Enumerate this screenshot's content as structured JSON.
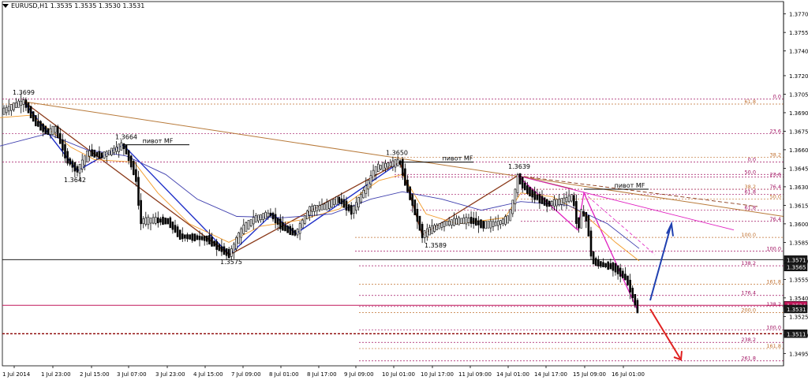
{
  "header": {
    "symbol_timeframe": "EURUSD,H1",
    "ohlc": "1.3535 1.3535 1.3530 1.3531"
  },
  "chart_data": {
    "type": "candlestick",
    "symbol": "EURUSD",
    "timeframe": "H1",
    "ylim": [
      1.3485,
      1.378
    ],
    "y_ticks": [
      "1.3770",
      "1.3755",
      "1.3740",
      "1.3720",
      "1.3705",
      "1.3690",
      "1.3675",
      "1.3660",
      "1.3645",
      "1.3630",
      "1.3615",
      "1.3600",
      "1.3585",
      "1.3570",
      "1.3555",
      "1.3540",
      "1.3525",
      "1.3510",
      "1.3495"
    ],
    "x_ticks": [
      "1 Jul 2014",
      "1 Jul 23:00",
      "2 Jul 15:00",
      "3 Jul 07:00",
      "3 Jul 23:00",
      "4 Jul 15:00",
      "7 Jul 09:00",
      "8 Jul 01:00",
      "8 Jul 17:00",
      "9 Jul 09:00",
      "10 Jul 01:00",
      "10 Jul 17:00",
      "11 Jul 09:00",
      "14 Jul 01:00",
      "14 Jul 17:00",
      "15 Jul 09:00",
      "16 Jul 01:00"
    ],
    "price_tags": [
      {
        "label": "1.3571",
        "value": 1.3571,
        "color": "#ffffff"
      },
      {
        "label": "1.3565",
        "value": 1.3565,
        "color": "#ffffff"
      },
      {
        "label": "1.3534",
        "value": 1.3534,
        "color": "#c2185b"
      },
      {
        "label": "1.3531",
        "value": 1.3531,
        "color": "#ffffff"
      },
      {
        "label": "1.3511",
        "value": 1.3511,
        "color": "#ffffff"
      }
    ],
    "swing_points": [
      {
        "label": "1.3699",
        "value": 1.3699
      },
      {
        "label": "1.3664",
        "value": 1.3664
      },
      {
        "label": "1.3642",
        "value": 1.3642
      },
      {
        "label": "1.3575",
        "value": 1.3575
      },
      {
        "label": "1.3650",
        "value": 1.365
      },
      {
        "label": "1.3589",
        "value": 1.3589
      },
      {
        "label": "1.3639",
        "value": 1.3639
      }
    ],
    "annotations": [
      {
        "text": "пивот MF",
        "value": 1.3664
      },
      {
        "text": "пивот MF",
        "value": 1.365
      },
      {
        "text": "пивот MF",
        "value": 1.3628
      }
    ],
    "fib_levels": [
      {
        "label": "0.0",
        "value": 1.3701
      },
      {
        "label": "61.8",
        "value": 1.3697
      },
      {
        "label": "23.6",
        "value": 1.3673
      },
      {
        "label": "0.0",
        "value": 1.365
      },
      {
        "label": "38.2",
        "value": 1.3654
      },
      {
        "label": "50.0",
        "value": 1.364
      },
      {
        "label": "23.6",
        "value": 1.3638
      },
      {
        "label": "38.2",
        "value": 1.3628
      },
      {
        "label": "76.4",
        "value": 1.3628
      },
      {
        "label": "61.8",
        "value": 1.3624
      },
      {
        "label": "50.0",
        "value": 1.362
      },
      {
        "label": "61.8",
        "value": 1.3611
      },
      {
        "label": "76.4",
        "value": 1.3602
      },
      {
        "label": "100.0",
        "value": 1.3589
      },
      {
        "label": "100.0",
        "value": 1.3578
      },
      {
        "label": "138.2",
        "value": 1.3566
      },
      {
        "label": "161.8",
        "value": 1.3551
      },
      {
        "label": "176.4",
        "value": 1.3542
      },
      {
        "label": "138.2",
        "value": 1.3533
      },
      {
        "label": "200.0",
        "value": 1.3528
      },
      {
        "label": "100.0",
        "value": 1.3514
      },
      {
        "label": "238.2",
        "value": 1.3504
      },
      {
        "label": "161.8",
        "value": 1.3499
      },
      {
        "label": "261.8",
        "value": 1.3489
      }
    ],
    "price_path": [
      [
        0,
        1.369
      ],
      [
        15,
        1.3695
      ],
      [
        30,
        1.3699
      ],
      [
        45,
        1.3682
      ],
      [
        60,
        1.3674
      ],
      [
        70,
        1.3677
      ],
      [
        85,
        1.3652
      ],
      [
        98,
        1.3643
      ],
      [
        112,
        1.3658
      ],
      [
        128,
        1.3655
      ],
      [
        145,
        1.366
      ],
      [
        156,
        1.3664
      ],
      [
        165,
        1.365
      ],
      [
        172,
        1.3638
      ],
      [
        178,
        1.3602
      ],
      [
        196,
        1.3603
      ],
      [
        213,
        1.3602
      ],
      [
        228,
        1.359
      ],
      [
        245,
        1.3589
      ],
      [
        262,
        1.3588
      ],
      [
        278,
        1.358
      ],
      [
        291,
        1.3575
      ],
      [
        306,
        1.3595
      ],
      [
        322,
        1.3604
      ],
      [
        342,
        1.3608
      ],
      [
        358,
        1.3597
      ],
      [
        375,
        1.3592
      ],
      [
        392,
        1.3612
      ],
      [
        412,
        1.3614
      ],
      [
        428,
        1.362
      ],
      [
        446,
        1.361
      ],
      [
        460,
        1.3625
      ],
      [
        476,
        1.3645
      ],
      [
        492,
        1.3648
      ],
      [
        507,
        1.365
      ],
      [
        515,
        1.363
      ],
      [
        522,
        1.3618
      ],
      [
        535,
        1.3591
      ],
      [
        548,
        1.3596
      ],
      [
        562,
        1.36
      ],
      [
        578,
        1.3602
      ],
      [
        596,
        1.3603
      ],
      [
        612,
        1.3599
      ],
      [
        628,
        1.36
      ],
      [
        644,
        1.3604
      ],
      [
        651,
        1.362
      ],
      [
        656,
        1.3638
      ],
      [
        666,
        1.3628
      ],
      [
        678,
        1.3622
      ],
      [
        694,
        1.3616
      ],
      [
        710,
        1.3618
      ],
      [
        726,
        1.3622
      ],
      [
        732,
        1.3595
      ],
      [
        737,
        1.361
      ],
      [
        744,
        1.3603
      ],
      [
        750,
        1.357
      ],
      [
        762,
        1.3567
      ],
      [
        778,
        1.3565
      ],
      [
        794,
        1.3555
      ],
      [
        808,
        1.353
      ]
    ],
    "series": [
      {
        "name": "",
        "color": "#f29a28",
        "values": [
          [
            0,
            1.3686
          ],
          [
            40,
            1.3688
          ],
          [
            90,
            1.3662
          ],
          [
            120,
            1.3652
          ],
          [
            170,
            1.365
          ],
          [
            200,
            1.3625
          ],
          [
            240,
            1.36
          ],
          [
            290,
            1.3585
          ],
          [
            330,
            1.3598
          ],
          [
            380,
            1.3603
          ],
          [
            430,
            1.3612
          ],
          [
            480,
            1.3635
          ],
          [
            510,
            1.364
          ],
          [
            540,
            1.3608
          ],
          [
            580,
            1.36
          ],
          [
            640,
            1.3605
          ],
          [
            660,
            1.3625
          ],
          [
            700,
            1.3622
          ],
          [
            740,
            1.3608
          ],
          [
            780,
            1.3585
          ],
          [
            810,
            1.357
          ]
        ]
      },
      {
        "name": "",
        "color": "#3f3fae",
        "values": [
          [
            0,
            1.3663
          ],
          [
            60,
            1.3673
          ],
          [
            110,
            1.366
          ],
          [
            160,
            1.3655
          ],
          [
            210,
            1.364
          ],
          [
            250,
            1.362
          ],
          [
            300,
            1.3606
          ],
          [
            360,
            1.3605
          ],
          [
            420,
            1.3608
          ],
          [
            470,
            1.362
          ],
          [
            510,
            1.3626
          ],
          [
            560,
            1.362
          ],
          [
            610,
            1.3611
          ],
          [
            660,
            1.3618
          ],
          [
            720,
            1.3615
          ],
          [
            770,
            1.36
          ],
          [
            810,
            1.358
          ]
        ]
      }
    ]
  }
}
